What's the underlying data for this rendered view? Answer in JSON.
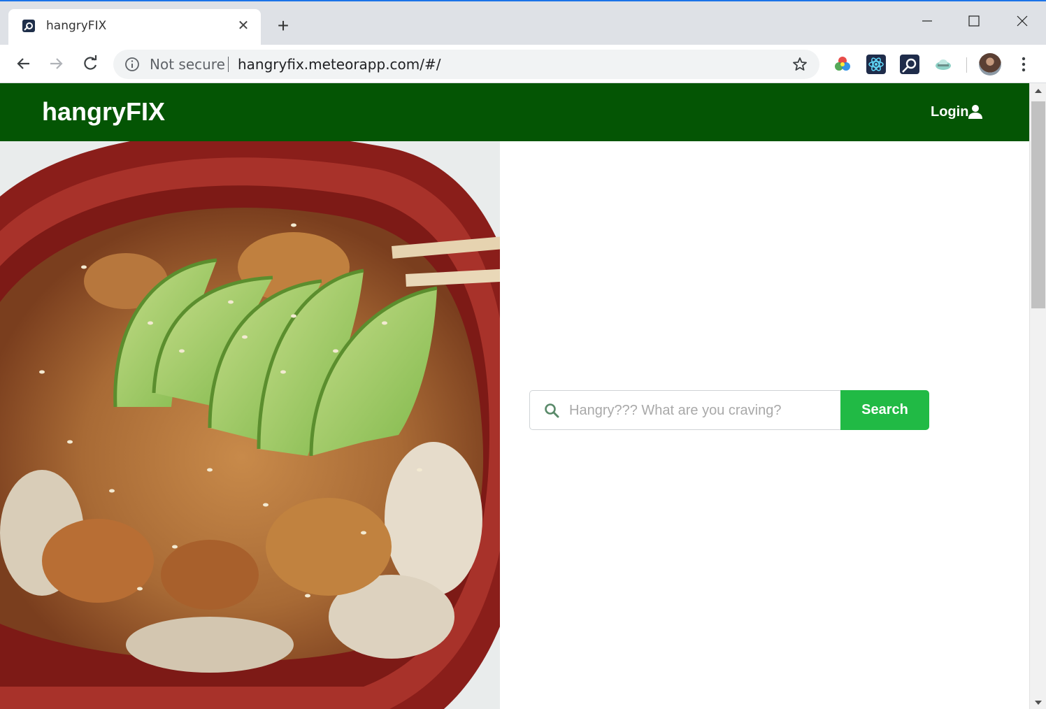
{
  "browser": {
    "tab": {
      "title": "hangryFIX",
      "favicon": "meteor-favicon-icon",
      "close_glyph": "✕"
    },
    "new_tab_glyph": "+",
    "omnibox": {
      "security_label": "Not secure",
      "url": "hangryfix.meteorapp.com/#/"
    },
    "extensions": [
      "color-picker-extension-icon",
      "react-devtools-icon",
      "meteor-devtools-icon",
      "cloud-extension-icon"
    ],
    "colors": {
      "tabstrip": "#dee1e6",
      "accent": "#1a73e8"
    }
  },
  "app": {
    "brand": "hangryFIX",
    "nav": {
      "login_label": "Login",
      "login_icon": "user-icon"
    },
    "hero": {
      "image": "poke-bowl-photo"
    },
    "search": {
      "placeholder": "Hangry??? What are you craving?",
      "value": "",
      "button_label": "Search",
      "icon": "search-icon"
    },
    "colors": {
      "navbar": "#045504",
      "search_button": "#21ba45"
    }
  }
}
